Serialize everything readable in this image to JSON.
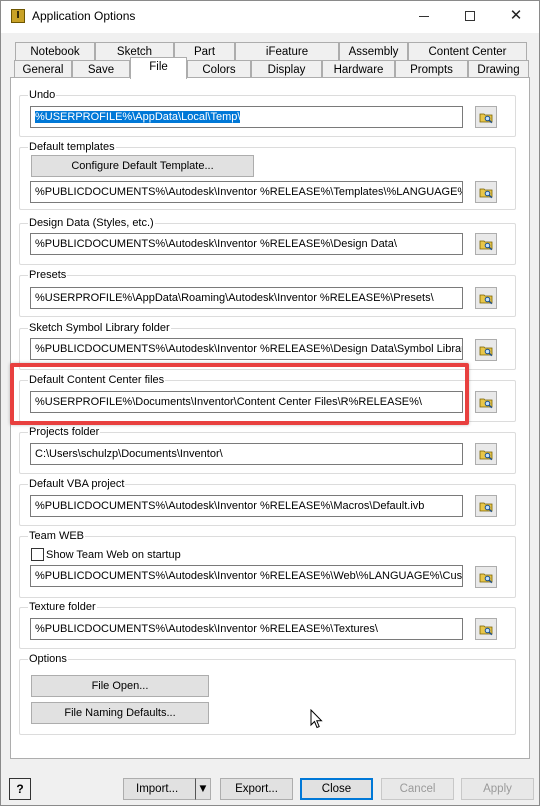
{
  "window": {
    "title": "Application Options"
  },
  "tabs_row1": [
    {
      "label": "Notebook"
    },
    {
      "label": "Sketch"
    },
    {
      "label": "Part"
    },
    {
      "label": "iFeature"
    },
    {
      "label": "Assembly"
    },
    {
      "label": "Content Center"
    }
  ],
  "tabs_row2": [
    {
      "label": "General"
    },
    {
      "label": "Save"
    },
    {
      "label": "File"
    },
    {
      "label": "Colors"
    },
    {
      "label": "Display"
    },
    {
      "label": "Hardware"
    },
    {
      "label": "Prompts"
    },
    {
      "label": "Drawing"
    }
  ],
  "active_tab": "File",
  "groups": {
    "undo": {
      "label": "Undo",
      "value": "%USERPROFILE%\\AppData\\Local\\Temp\\"
    },
    "default_templates": {
      "label": "Default templates",
      "button": "Configure Default Template...",
      "value": "%PUBLICDOCUMENTS%\\Autodesk\\Inventor %RELEASE%\\Templates\\%LANGUAGE%\\"
    },
    "design_data": {
      "label": "Design Data (Styles, etc.)",
      "value": "%PUBLICDOCUMENTS%\\Autodesk\\Inventor %RELEASE%\\Design Data\\"
    },
    "presets": {
      "label": "Presets",
      "value": "%USERPROFILE%\\AppData\\Roaming\\Autodesk\\Inventor %RELEASE%\\Presets\\"
    },
    "sketch_symbol": {
      "label": "Sketch Symbol Library folder",
      "value": "%PUBLICDOCUMENTS%\\Autodesk\\Inventor %RELEASE%\\Design Data\\Symbol Library\\"
    },
    "content_center": {
      "label": "Default Content Center files",
      "value": "%USERPROFILE%\\Documents\\Inventor\\Content Center Files\\R%RELEASE%\\"
    },
    "projects": {
      "label": "Projects folder",
      "value": "C:\\Users\\schulzp\\Documents\\Inventor\\"
    },
    "vba": {
      "label": "Default VBA project",
      "value": "%PUBLICDOCUMENTS%\\Autodesk\\Inventor %RELEASE%\\Macros\\Default.ivb"
    },
    "team_web": {
      "label": "Team WEB",
      "checkbox": "Show Team Web on startup",
      "checked": false,
      "value": "%PUBLICDOCUMENTS%\\Autodesk\\Inventor %RELEASE%\\Web\\%LANGUAGE%\\Custom"
    },
    "texture": {
      "label": "Texture folder",
      "value": "%PUBLICDOCUMENTS%\\Autodesk\\Inventor %RELEASE%\\Textures\\"
    },
    "options": {
      "label": "Options",
      "file_open": "File Open...",
      "naming": "File Naming Defaults..."
    }
  },
  "footer": {
    "help": "?",
    "import": "Import...",
    "export": "Export...",
    "close": "Close",
    "cancel": "Cancel",
    "apply": "Apply"
  },
  "icons": {
    "browse": "folder-browse-icon",
    "cursor": "mouse-pointer-icon"
  },
  "colors": {
    "highlight": "#e8403f",
    "selection": "#0078d7"
  }
}
